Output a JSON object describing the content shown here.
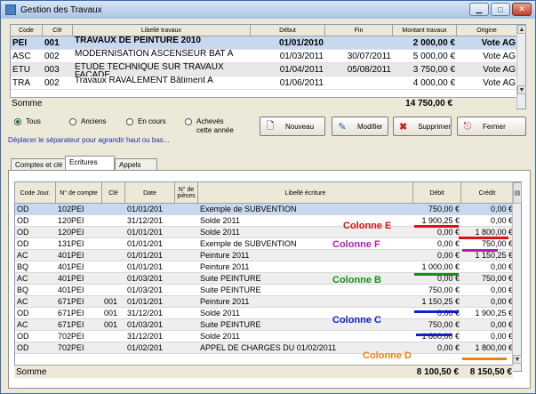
{
  "window": {
    "title": "Gestion des Travaux"
  },
  "grid1": {
    "columns": [
      "Code",
      "Clé",
      "Libellé travaux",
      "Début",
      "Fin",
      "Montant travaux",
      "Origine"
    ],
    "rows": [
      {
        "code": "PEI",
        "cle": "001",
        "libelle": "TRAVAUX DE PEINTURE 2010",
        "debut": "01/01/2010",
        "fin": "",
        "montant": "2 000,00 €",
        "origine": "Vote AG"
      },
      {
        "code": "ASC",
        "cle": "002",
        "libelle": "MODERNISATION ASCENSEUR BAT A",
        "debut": "01/03/2011",
        "fin": "30/07/2011",
        "montant": "5 000,00 €",
        "origine": "Vote AG"
      },
      {
        "code": "ETU",
        "cle": "003",
        "libelle": "ETUDE TECHNIQUE SUR TRAVAUX FACADE",
        "debut": "01/04/2011",
        "fin": "05/08/2011",
        "montant": "3 750,00 €",
        "origine": "Vote AG"
      },
      {
        "code": "TRA",
        "cle": "002",
        "libelle": "Travaux RAVALEMENT Bâtiment A",
        "debut": "01/06/2011",
        "fin": "",
        "montant": "4 000,00 €",
        "origine": "Vote AG"
      }
    ],
    "somme_label": "Somme",
    "somme_value": "14 750,00 €"
  },
  "filters": {
    "options": [
      "Tous",
      "Anciens",
      "En cours",
      "Achevés cette année"
    ],
    "selected": "Tous",
    "hint": "Déplacer le séparateur pour agrandir haut ou bas..."
  },
  "buttons": {
    "nouveau": "Nouveau",
    "modifier": "Modifier",
    "supprimer": "Supprimer",
    "fermer": "Fermer"
  },
  "tabs": [
    "Comptes et clé",
    "Ecritures",
    "Appels"
  ],
  "active_tab": "Ecritures",
  "grid2": {
    "columns": [
      "Code Jour.",
      "N° de compte",
      "Clé",
      "Date",
      "N° de pièces",
      "Libellé écriture",
      "Débit",
      "Crédit"
    ],
    "rows": [
      {
        "jour": "OD",
        "compte": "102PEI",
        "cle": "",
        "date": "01/01/201",
        "piece": "",
        "libelle": "Exemple de SUBVENTION",
        "debit": "750,00 €",
        "credit": "0,00 €"
      },
      {
        "jour": "OD",
        "compte": "120PEI",
        "cle": "",
        "date": "31/12/201",
        "piece": "",
        "libelle": "Solde 2011",
        "debit": "1 900,25 €",
        "credit": "0,00 €"
      },
      {
        "jour": "OD",
        "compte": "120PEI",
        "cle": "",
        "date": "01/01/201",
        "piece": "",
        "libelle": "Solde 2011",
        "debit": "0,00 €",
        "credit": "1 800,00 €"
      },
      {
        "jour": "OD",
        "compte": "131PEI",
        "cle": "",
        "date": "01/01/201",
        "piece": "",
        "libelle": "Exemple de SUBVENTION",
        "debit": "0,00 €",
        "credit": "750,00 €"
      },
      {
        "jour": "AC",
        "compte": "401PEI",
        "cle": "",
        "date": "01/01/201",
        "piece": "",
        "libelle": "Peinture 2011",
        "debit": "0,00 €",
        "credit": "1 150,25 €"
      },
      {
        "jour": "BQ",
        "compte": "401PEI",
        "cle": "",
        "date": "01/01/201",
        "piece": "",
        "libelle": "Peinture 2011",
        "debit": "1 000,00 €",
        "credit": "0,00 €"
      },
      {
        "jour": "AC",
        "compte": "401PEI",
        "cle": "",
        "date": "01/03/201",
        "piece": "",
        "libelle": "Suite PEINTURE",
        "debit": "0,00 €",
        "credit": "750,00 €"
      },
      {
        "jour": "BQ",
        "compte": "401PEI",
        "cle": "",
        "date": "01/03/201",
        "piece": "",
        "libelle": "Suite PEINTURE",
        "debit": "750,00 €",
        "credit": "0,00 €"
      },
      {
        "jour": "AC",
        "compte": "671PEI",
        "cle": "001",
        "date": "01/01/201",
        "piece": "",
        "libelle": "Peinture 2011",
        "debit": "1 150,25 €",
        "credit": "0,00 €"
      },
      {
        "jour": "OD",
        "compte": "671PEI",
        "cle": "001",
        "date": "31/12/201",
        "piece": "",
        "libelle": "Solde 2011",
        "debit": "0,00 €",
        "credit": "1 900,25 €"
      },
      {
        "jour": "AC",
        "compte": "671PEI",
        "cle": "001",
        "date": "01/03/201",
        "piece": "",
        "libelle": "Suite PEINTURE",
        "debit": "750,00 €",
        "credit": "0,00 €"
      },
      {
        "jour": "OD",
        "compte": "702PEI",
        "cle": "",
        "date": "31/12/201",
        "piece": "",
        "libelle": "Solde 2011",
        "debit": "1 800,00 €",
        "credit": "0,00 €"
      },
      {
        "jour": "OD",
        "compte": "702PEI",
        "cle": "",
        "date": "01/02/201",
        "piece": "",
        "libelle": "APPEL DE CHARGES DU 01/02/2011",
        "debit": "0,00 €",
        "credit": "1 800,00 €"
      }
    ],
    "somme_label": "Somme",
    "somme_debit": "8 100,50 €",
    "somme_credit": "8 150,50 €"
  },
  "annotations": [
    {
      "text": "Colonne E",
      "color": "#e01010"
    },
    {
      "text": "Colonne F",
      "color": "#b020b0"
    },
    {
      "text": "Colonne B",
      "color": "#159015"
    },
    {
      "text": "Colonne C",
      "color": "#1020d0"
    },
    {
      "text": "Colonne D",
      "color": "#f08010"
    }
  ]
}
